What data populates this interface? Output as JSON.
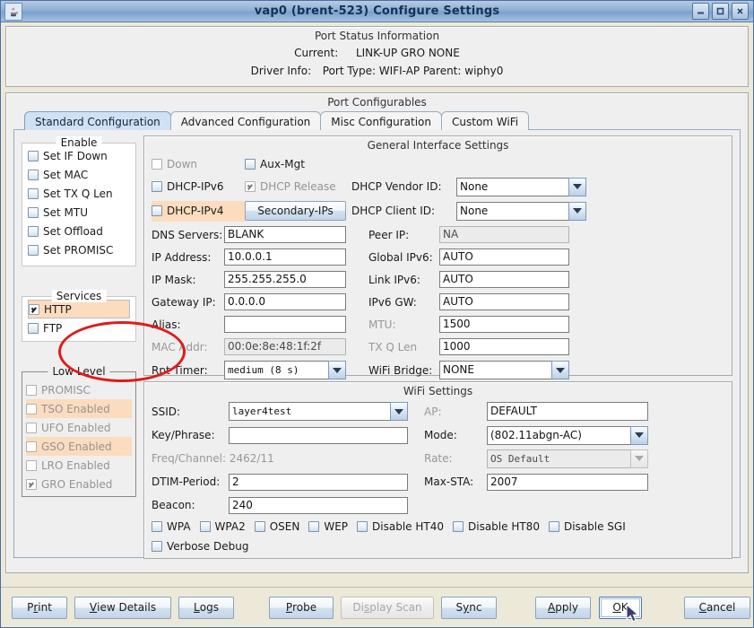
{
  "window": {
    "title": "vap0  (brent-523) Configure Settings",
    "icon": "java-coffee-icon",
    "controls": [
      {
        "name": "minimize-button",
        "glyph": "minimize"
      },
      {
        "name": "maximize-button",
        "glyph": "maximize"
      },
      {
        "name": "close-button",
        "glyph": "close"
      }
    ]
  },
  "status_panel": {
    "title": "Port Status Information",
    "current_label": "Current:",
    "current_value": "LINK-UP GRO  NONE",
    "driver_label": "Driver Info:",
    "driver_value": "Port Type: WIFI-AP   Parent: wiphy0"
  },
  "configurables": {
    "title": "Port Configurables",
    "tabs": [
      {
        "label": "Standard Configuration",
        "selected": true
      },
      {
        "label": "Advanced Configuration",
        "selected": false
      },
      {
        "label": "Misc Configuration",
        "selected": false
      },
      {
        "label": "Custom WiFi",
        "selected": false
      }
    ]
  },
  "enable_group": {
    "title": "Enable",
    "items": [
      {
        "label": "Set IF Down",
        "checked": false
      },
      {
        "label": "Set MAC",
        "checked": false
      },
      {
        "label": "Set TX Q Len",
        "checked": false
      },
      {
        "label": "Set MTU",
        "checked": false
      },
      {
        "label": "Set Offload",
        "checked": false
      },
      {
        "label": "Set PROMISC",
        "checked": false
      }
    ]
  },
  "services_group": {
    "title": "Services",
    "items": [
      {
        "label": "HTTP",
        "checked": true,
        "highlight": true
      },
      {
        "label": "FTP",
        "checked": false,
        "highlight": false
      }
    ]
  },
  "lowlevel_group": {
    "title": "Low Level",
    "items": [
      {
        "label": "PROMISC",
        "checked": false,
        "highlight": false
      },
      {
        "label": "TSO Enabled",
        "checked": false,
        "highlight": true
      },
      {
        "label": "UFO Enabled",
        "checked": false,
        "highlight": false
      },
      {
        "label": "GSO Enabled",
        "checked": false,
        "highlight": true
      },
      {
        "label": "LRO Enabled",
        "checked": false,
        "highlight": false
      },
      {
        "label": "GRO Enabled",
        "checked": true,
        "highlight": false
      }
    ]
  },
  "general": {
    "title": "General Interface Settings",
    "down_label": "Down",
    "auxmgt_label": "Aux-Mgt",
    "dhcp_ipv6_label": "DHCP-IPv6",
    "dhcp_release_label": "DHCP Release",
    "dhcp_ipv4_label": "DHCP-IPv4",
    "secondary_ips_label": "Secondary-IPs",
    "dhcp_vendor_label": "DHCP Vendor ID:",
    "dhcp_vendor_value": "None",
    "dhcp_client_label": "DHCP Client ID:",
    "dhcp_client_value": "None",
    "dns_label": "DNS Servers:",
    "dns_value": "BLANK",
    "peer_ip_label": "Peer IP:",
    "peer_ip_value": "NA",
    "ip_addr_label": "IP Address:",
    "ip_addr_value": "10.0.0.1",
    "global_ipv6_label": "Global IPv6:",
    "global_ipv6_value": "AUTO",
    "ip_mask_label": "IP Mask:",
    "ip_mask_value": "255.255.255.0",
    "link_ipv6_label": "Link IPv6:",
    "link_ipv6_value": "AUTO",
    "gateway_label": "Gateway IP:",
    "gateway_value": "0.0.0.0",
    "ipv6_gw_label": "IPv6 GW:",
    "ipv6_gw_value": "AUTO",
    "alias_label": "Alias:",
    "alias_value": "",
    "mtu_label": "MTU:",
    "mtu_value": "1500",
    "mac_label": "MAC Addr:",
    "mac_value": "00:0e:8e:48:1f:2f",
    "txqlen_label": "TX Q Len",
    "txqlen_value": "1000",
    "rpt_timer_label": "Rpt Timer:",
    "rpt_timer_value": "medium  (8 s)",
    "wifi_bridge_label": "WiFi Bridge:",
    "wifi_bridge_value": "NONE"
  },
  "wifi": {
    "title": "WiFi Settings",
    "ssid_label": "SSID:",
    "ssid_value": "layer4test",
    "ap_label": "AP:",
    "ap_value": "DEFAULT",
    "key_label": "Key/Phrase:",
    "key_value": "",
    "mode_label": "Mode:",
    "mode_value": "(802.11abgn-AC)",
    "freq_label": "Freq/Channel: 2462/11",
    "rate_label": "Rate:",
    "rate_value": "OS Default",
    "dtim_label": "DTIM-Period:",
    "dtim_value": "2",
    "maxsta_label": "Max-STA:",
    "maxsta_value": "2007",
    "beacon_label": "Beacon:",
    "beacon_value": "240",
    "flags": [
      {
        "label": "WPA",
        "checked": false
      },
      {
        "label": "WPA2",
        "checked": false
      },
      {
        "label": "OSEN",
        "checked": false
      },
      {
        "label": "WEP",
        "checked": false
      },
      {
        "label": "Disable HT40",
        "checked": false
      },
      {
        "label": "Disable HT80",
        "checked": false
      },
      {
        "label": "Disable SGI",
        "checked": false
      }
    ],
    "verbose_label": "Verbose Debug",
    "verbose_checked": false
  },
  "buttons": {
    "print": {
      "pre": "P",
      "mn": "r",
      "post": "int",
      "enabled": true
    },
    "view_details": {
      "pre": "",
      "mn": "V",
      "post": "iew Details",
      "enabled": true
    },
    "logs": {
      "pre": "",
      "mn": "L",
      "post": "ogs",
      "enabled": true
    },
    "probe": {
      "pre": "",
      "mn": "P",
      "post": "robe",
      "enabled": true
    },
    "display_scan": {
      "pre": "Di",
      "mn": "s",
      "post": "play Scan",
      "enabled": false
    },
    "sync": {
      "pre": "S",
      "mn": "y",
      "post": "nc",
      "enabled": true
    },
    "apply": {
      "pre": "",
      "mn": "A",
      "post": "pply",
      "enabled": true
    },
    "ok": {
      "pre": "",
      "mn": "O",
      "post": "K",
      "enabled": true,
      "focused": true
    },
    "cancel": {
      "pre": "",
      "mn": "C",
      "post": "ancel",
      "enabled": true
    }
  },
  "annotation": {
    "ellipse_color": "#e01b1b",
    "target": "services-group"
  }
}
